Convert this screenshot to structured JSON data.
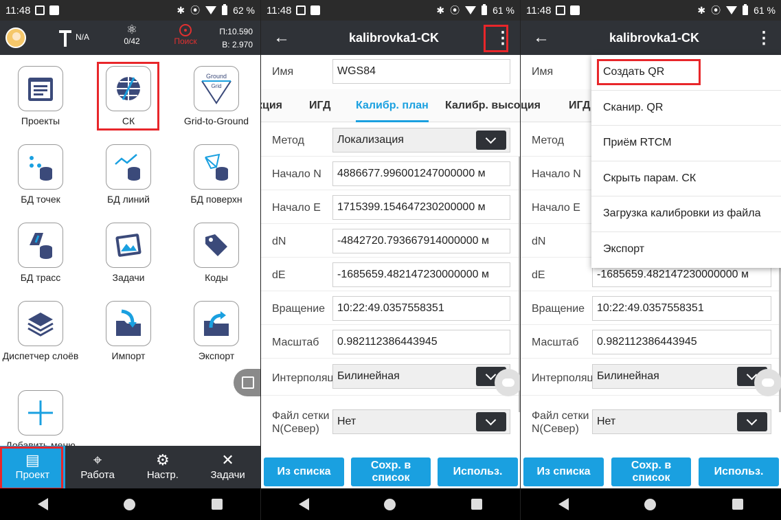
{
  "status": [
    {
      "time": "11:48",
      "battery": "62 %"
    },
    {
      "time": "11:48",
      "battery": "61 %"
    },
    {
      "time": "11:48",
      "battery": "61 %"
    }
  ],
  "home": {
    "gps_label": "N/A",
    "satellites": "0/42",
    "search_label": "Поиск",
    "p_value": "П:10.590",
    "b_value": "В: 2.970",
    "tiles": [
      "Проекты",
      "СК",
      "Grid-to-Ground",
      "БД точек",
      "БД линий",
      "БД поверхн",
      "БД трасс",
      "Задачи",
      "Коды",
      "Диспетчер слоёв",
      "Импорт",
      "Экспорт",
      "Добавить меню"
    ],
    "ground_text": "Ground",
    "grid_text": "Grid",
    "bottom_nav": [
      "Проект",
      "Работа",
      "Настр.",
      "Задачи"
    ]
  },
  "calib": {
    "title": "kalibrovka1-CK",
    "name_label": "Имя",
    "name_value": "WGS84",
    "tabs": [
      "кция",
      "ИГД",
      "Калибр. план",
      "Калибр. высо"
    ],
    "tabs_right": [
      "кция",
      "ИГД"
    ],
    "rows": [
      {
        "label": "Метод",
        "value": "Локализация"
      },
      {
        "label": "Начало N",
        "value": "4886677.996001247000000 м"
      },
      {
        "label": "Начало E",
        "value": "1715399.154647230200000 м"
      },
      {
        "label": "dN",
        "value": "-4842720.793667914000000 м"
      },
      {
        "label": "dE",
        "value": "-1685659.482147230000000 м"
      },
      {
        "label": "Вращение",
        "value": "10:22:49.0357558351"
      },
      {
        "label": "Масштаб",
        "value": "0.982112386443945"
      },
      {
        "label": "Интерполяция",
        "value": "Билинейная"
      },
      {
        "label": "Файл сетки N(Север)",
        "value": "Нет"
      }
    ],
    "buttons": [
      "Из списка",
      "Сохр. в список",
      "Использ."
    ]
  },
  "menu": {
    "items": [
      "Создать QR",
      "Сканир. QR",
      "Приём RTCM",
      "Скрыть парам. СК",
      "Загрузка калибровки из файла",
      "Экспорт"
    ]
  },
  "colors": {
    "accent": "#1aa0e0",
    "highlight": "#e8262a",
    "appbar": "#2f3237"
  }
}
